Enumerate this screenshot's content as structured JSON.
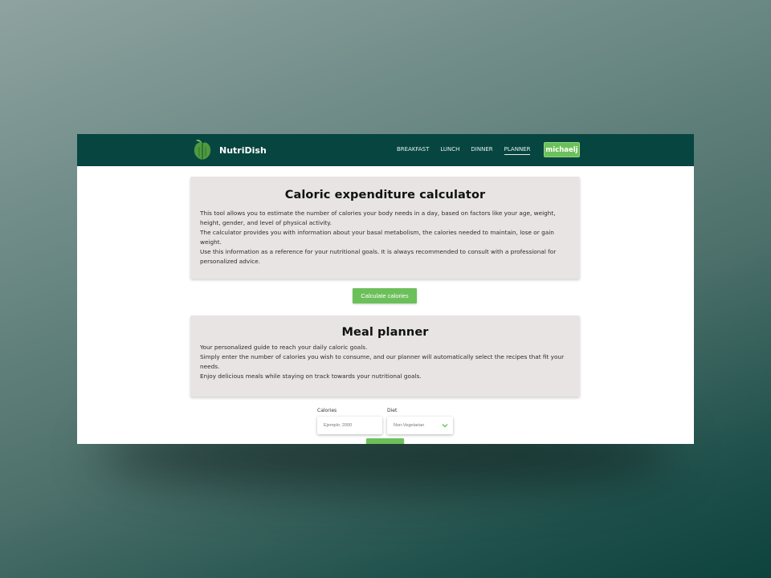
{
  "app": {
    "name": "NutriDish"
  },
  "nav": {
    "links": [
      "BREAKFAST",
      "LUNCH",
      "DINNER",
      "PLANNER"
    ],
    "active": "PLANNER",
    "user": "michaelj"
  },
  "calculator": {
    "title": "Caloric expenditure calculator",
    "lines": [
      "This tool allows you to estimate the number of calories your body needs in a day, based on factors like your age, weight, height, gender, and level of physical activity.",
      "The calculator provides you with information about your basal metabolism, the calories needed to maintain, lose or gain weight.",
      "Use this information as a reference for your nutritional goals. It is always recommended to consult with a professional for personalized advice."
    ],
    "button": "Calculate calories"
  },
  "planner": {
    "title": "Meal planner",
    "lines": [
      "Your personalized guide to reach your daily caloric goals.",
      "Simply enter the number of calories you wish to consume, and our planner will automatically select the recipes that fit your needs.",
      "Enjoy delicious meals while staying on track towards your nutritional goals."
    ],
    "calories_label": "Calories",
    "calories_placeholder": "Ejemplo: 2000",
    "diet_label": "Diet",
    "diet_value": "Non-Vegetarian"
  },
  "colors": {
    "navbar": "#074640",
    "accent": "#6cc05a",
    "card": "#e8e4e4"
  },
  "icons": {
    "logo": "leaf-spoon-logo",
    "dropdown": "chevron-down-icon"
  }
}
